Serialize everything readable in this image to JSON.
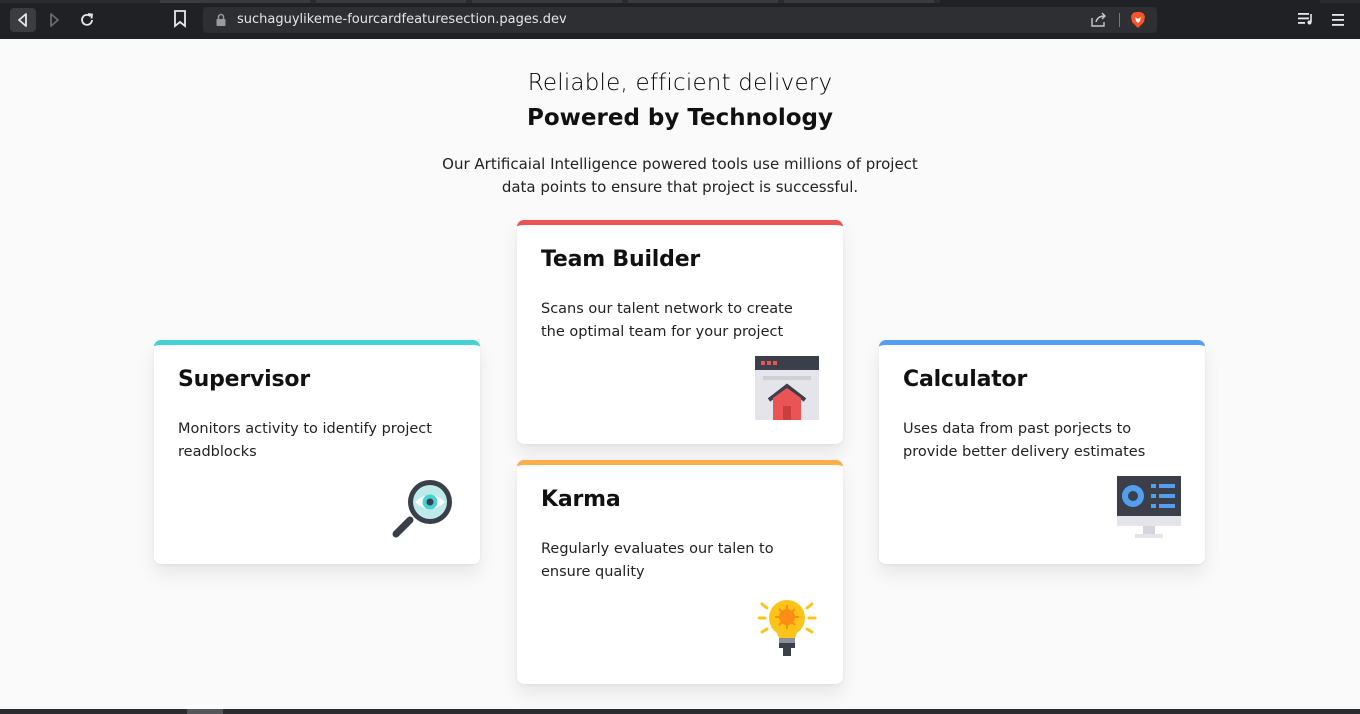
{
  "browser": {
    "url": "suchaguylikeme-fourcardfeaturesection.pages.dev",
    "icons": [
      "back-icon",
      "forward-icon",
      "reload-icon",
      "bookmark-icon",
      "lock-icon",
      "share-icon",
      "brave-icon",
      "playlist-icon",
      "menu-icon"
    ]
  },
  "header": {
    "subtitle": "Reliable, efficient delivery",
    "title": "Powered by Technology",
    "description": "Our Artificaial Intelligence powered tools use millions of project data points to ensure that project is successful."
  },
  "cards": {
    "supervisor": {
      "title": "Supervisor",
      "text": "Monitors activity to identify project readblocks",
      "accent": "#44d3d2",
      "icon": "magnifier-eye-icon"
    },
    "team": {
      "title": "Team Builder",
      "text": "Scans our talent network to create the optimal team for your project",
      "accent": "#ea5454",
      "icon": "browser-home-icon"
    },
    "karma": {
      "title": "Karma",
      "text": "Regularly evaluates our talen to ensure quality",
      "accent": "#fcae4a",
      "icon": "lightbulb-icon"
    },
    "calculator": {
      "title": "Calculator",
      "text": "Uses data from past porjects to provide better delivery estimates",
      "accent": "#549ef2",
      "icon": "monitor-dashboard-icon"
    }
  }
}
